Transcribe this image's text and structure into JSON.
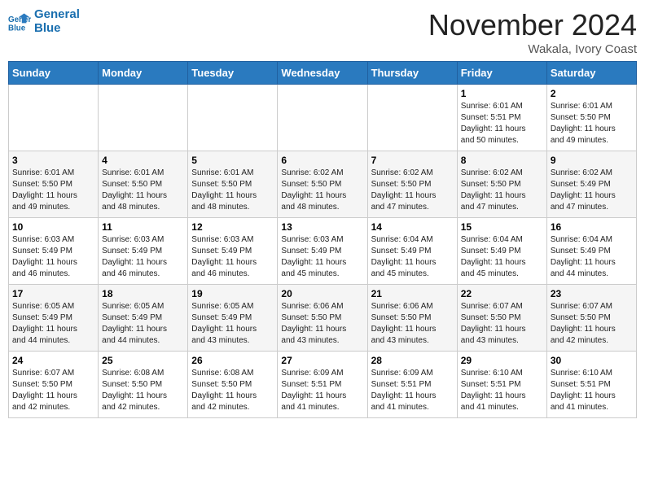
{
  "header": {
    "logo_line1": "General",
    "logo_line2": "Blue",
    "month": "November 2024",
    "location": "Wakala, Ivory Coast"
  },
  "days_of_week": [
    "Sunday",
    "Monday",
    "Tuesday",
    "Wednesday",
    "Thursday",
    "Friday",
    "Saturday"
  ],
  "weeks": [
    [
      {
        "day": "",
        "info": ""
      },
      {
        "day": "",
        "info": ""
      },
      {
        "day": "",
        "info": ""
      },
      {
        "day": "",
        "info": ""
      },
      {
        "day": "",
        "info": ""
      },
      {
        "day": "1",
        "info": "Sunrise: 6:01 AM\nSunset: 5:51 PM\nDaylight: 11 hours\nand 50 minutes."
      },
      {
        "day": "2",
        "info": "Sunrise: 6:01 AM\nSunset: 5:50 PM\nDaylight: 11 hours\nand 49 minutes."
      }
    ],
    [
      {
        "day": "3",
        "info": "Sunrise: 6:01 AM\nSunset: 5:50 PM\nDaylight: 11 hours\nand 49 minutes."
      },
      {
        "day": "4",
        "info": "Sunrise: 6:01 AM\nSunset: 5:50 PM\nDaylight: 11 hours\nand 48 minutes."
      },
      {
        "day": "5",
        "info": "Sunrise: 6:01 AM\nSunset: 5:50 PM\nDaylight: 11 hours\nand 48 minutes."
      },
      {
        "day": "6",
        "info": "Sunrise: 6:02 AM\nSunset: 5:50 PM\nDaylight: 11 hours\nand 48 minutes."
      },
      {
        "day": "7",
        "info": "Sunrise: 6:02 AM\nSunset: 5:50 PM\nDaylight: 11 hours\nand 47 minutes."
      },
      {
        "day": "8",
        "info": "Sunrise: 6:02 AM\nSunset: 5:50 PM\nDaylight: 11 hours\nand 47 minutes."
      },
      {
        "day": "9",
        "info": "Sunrise: 6:02 AM\nSunset: 5:49 PM\nDaylight: 11 hours\nand 47 minutes."
      }
    ],
    [
      {
        "day": "10",
        "info": "Sunrise: 6:03 AM\nSunset: 5:49 PM\nDaylight: 11 hours\nand 46 minutes."
      },
      {
        "day": "11",
        "info": "Sunrise: 6:03 AM\nSunset: 5:49 PM\nDaylight: 11 hours\nand 46 minutes."
      },
      {
        "day": "12",
        "info": "Sunrise: 6:03 AM\nSunset: 5:49 PM\nDaylight: 11 hours\nand 46 minutes."
      },
      {
        "day": "13",
        "info": "Sunrise: 6:03 AM\nSunset: 5:49 PM\nDaylight: 11 hours\nand 45 minutes."
      },
      {
        "day": "14",
        "info": "Sunrise: 6:04 AM\nSunset: 5:49 PM\nDaylight: 11 hours\nand 45 minutes."
      },
      {
        "day": "15",
        "info": "Sunrise: 6:04 AM\nSunset: 5:49 PM\nDaylight: 11 hours\nand 45 minutes."
      },
      {
        "day": "16",
        "info": "Sunrise: 6:04 AM\nSunset: 5:49 PM\nDaylight: 11 hours\nand 44 minutes."
      }
    ],
    [
      {
        "day": "17",
        "info": "Sunrise: 6:05 AM\nSunset: 5:49 PM\nDaylight: 11 hours\nand 44 minutes."
      },
      {
        "day": "18",
        "info": "Sunrise: 6:05 AM\nSunset: 5:49 PM\nDaylight: 11 hours\nand 44 minutes."
      },
      {
        "day": "19",
        "info": "Sunrise: 6:05 AM\nSunset: 5:49 PM\nDaylight: 11 hours\nand 43 minutes."
      },
      {
        "day": "20",
        "info": "Sunrise: 6:06 AM\nSunset: 5:50 PM\nDaylight: 11 hours\nand 43 minutes."
      },
      {
        "day": "21",
        "info": "Sunrise: 6:06 AM\nSunset: 5:50 PM\nDaylight: 11 hours\nand 43 minutes."
      },
      {
        "day": "22",
        "info": "Sunrise: 6:07 AM\nSunset: 5:50 PM\nDaylight: 11 hours\nand 43 minutes."
      },
      {
        "day": "23",
        "info": "Sunrise: 6:07 AM\nSunset: 5:50 PM\nDaylight: 11 hours\nand 42 minutes."
      }
    ],
    [
      {
        "day": "24",
        "info": "Sunrise: 6:07 AM\nSunset: 5:50 PM\nDaylight: 11 hours\nand 42 minutes."
      },
      {
        "day": "25",
        "info": "Sunrise: 6:08 AM\nSunset: 5:50 PM\nDaylight: 11 hours\nand 42 minutes."
      },
      {
        "day": "26",
        "info": "Sunrise: 6:08 AM\nSunset: 5:50 PM\nDaylight: 11 hours\nand 42 minutes."
      },
      {
        "day": "27",
        "info": "Sunrise: 6:09 AM\nSunset: 5:51 PM\nDaylight: 11 hours\nand 41 minutes."
      },
      {
        "day": "28",
        "info": "Sunrise: 6:09 AM\nSunset: 5:51 PM\nDaylight: 11 hours\nand 41 minutes."
      },
      {
        "day": "29",
        "info": "Sunrise: 6:10 AM\nSunset: 5:51 PM\nDaylight: 11 hours\nand 41 minutes."
      },
      {
        "day": "30",
        "info": "Sunrise: 6:10 AM\nSunset: 5:51 PM\nDaylight: 11 hours\nand 41 minutes."
      }
    ]
  ]
}
